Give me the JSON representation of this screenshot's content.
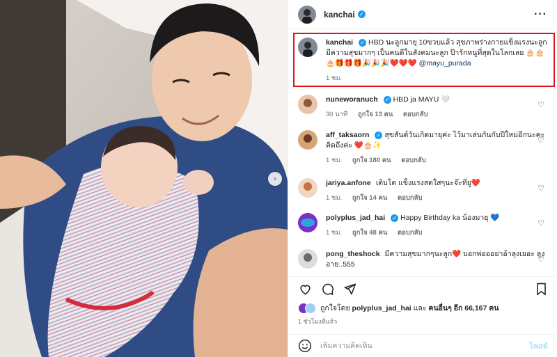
{
  "header": {
    "username": "kanchai"
  },
  "caption": {
    "username": "kanchai",
    "text": "HBD นะลูกมายุ 10ขวบแล้ว สุขภาพร่างกายแข็งแรงนะลูก มีความสุขมากๆ เป็นคนดีในสังคมนะลูก ป๊ารักหนูที่สุดในโลกเลย 🎂🎂",
    "emoji_line": "🎂🎁🎁🎁🎉🎉🎉❤️❤️❤️",
    "mention": "@mayu_purada",
    "time": "1 ชม."
  },
  "comments": [
    {
      "username": "nuneworanuch",
      "verified": true,
      "text": "HBD ja MAYU 🤍",
      "time": "30 นาที",
      "likes": "ถูกใจ 13 คน",
      "reply": "ตอบกลับ"
    },
    {
      "username": "aff_taksaorn",
      "verified": true,
      "text": "สุขสันต์วันเกิดมายุค่ะ ไว้มาเล่นกันกับปีใหม่อีกนะคะ คิดถึงค่ะ ❤️🎂✨",
      "time": "1 ชม.",
      "likes": "ถูกใจ 180 คน",
      "reply": "ตอบกลับ"
    },
    {
      "username": "jariya.anfone",
      "verified": false,
      "text": "เติบโต แข็งแรงสดใสๆนะจ๊ะที่ยู❤️",
      "time": "1 ชม.",
      "likes": "ถูกใจ 14 คน",
      "reply": "ตอบกลับ"
    },
    {
      "username": "polyplus_jad_hai",
      "verified": true,
      "text": "Happy Birthday ka น้องมายุ 💙",
      "time": "1 ชม.",
      "likes": "ถูกใจ 48 คน",
      "reply": "ตอบกลับ"
    },
    {
      "username": "pong_theshock",
      "verified": false,
      "text": "มีความสุขมากๆนะลูก❤️ บอกพ่อออย่าอ้าลุงเยอะ ลุงอาย..555",
      "time": "",
      "likes": "",
      "reply": ""
    }
  ],
  "likes": {
    "prefix": "ถูกใจโดย",
    "user": "polyplus_jad_hai",
    "joiner": "และ",
    "others": "คนอื่นๆ อีก 66,167 คน"
  },
  "time_ago": "1 ชั่วโมงที่แล้ว",
  "composer": {
    "placeholder": "เพิ่มความคิดเห็น",
    "post_label": "โพสต์"
  },
  "colors": {
    "verified": "#1d9bf0",
    "highlight_border": "#e0141d",
    "post_button": "#b2dffc"
  },
  "icons": {
    "actions": [
      "heart-icon",
      "comment-icon",
      "share-icon",
      "bookmark-icon"
    ],
    "composer": "emoji-icon",
    "photo_nav": "chevron-right-icon"
  }
}
